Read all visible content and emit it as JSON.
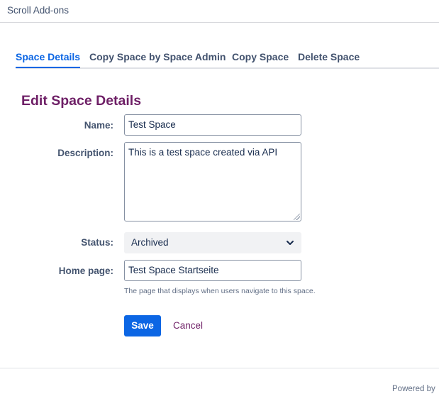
{
  "header": {
    "app_title": "Scroll Add-ons"
  },
  "tabs": [
    {
      "label": "Space Details",
      "active": true
    },
    {
      "label": "Copy Space by Space Admin",
      "active": false
    },
    {
      "label": "Copy Space",
      "active": false
    },
    {
      "label": "Delete Space",
      "active": false
    }
  ],
  "form": {
    "heading": "Edit Space Details",
    "name": {
      "label": "Name:",
      "value": "Test Space"
    },
    "description": {
      "label": "Description:",
      "value": "This is a test space created via API"
    },
    "status": {
      "label": "Status:",
      "value": "Archived"
    },
    "home_page": {
      "label": "Home page:",
      "value": "Test Space Startseite",
      "hint": "The page that displays when users navigate to this space."
    },
    "save_label": "Save",
    "cancel_label": "Cancel"
  },
  "footer": {
    "powered_by": "Powered by"
  },
  "colors": {
    "accent": "#0c66e4",
    "heading": "#6e1f66",
    "cancel_link": "#6e1f66"
  },
  "icons": {
    "status_dropdown": "chevron-down-icon"
  }
}
